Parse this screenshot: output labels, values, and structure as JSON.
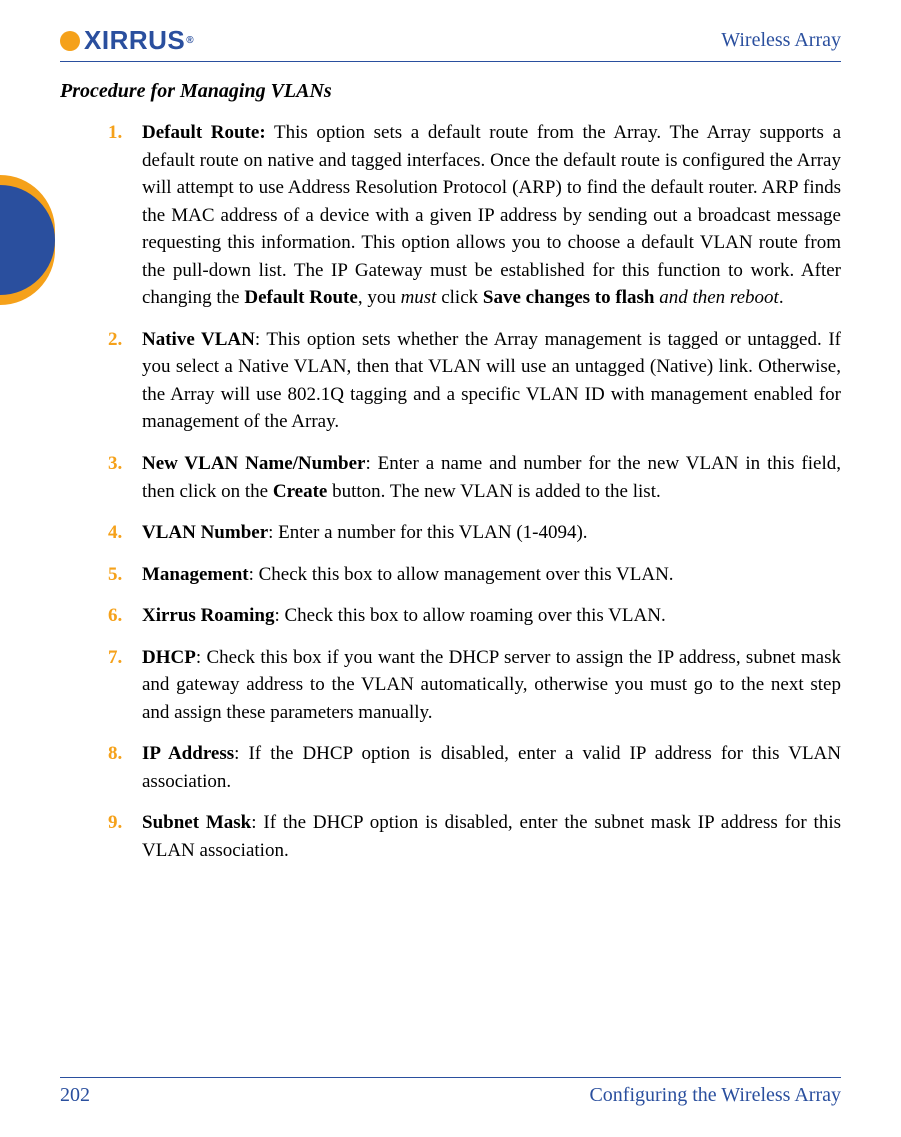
{
  "header": {
    "logo_text": "XIRRUS",
    "logo_reg": "®",
    "right": "Wireless Array"
  },
  "section_title": "Procedure for Managing VLANs",
  "steps": [
    {
      "num": "1.",
      "lead": "Default Route:",
      "text_a": " This option sets a default route from the Array. The Array supports a default route on native and tagged interfaces. Once the default route is configured the Array will attempt to use Address Resolution Protocol (ARP) to find the default router. ARP finds the MAC address of a device with a given IP address by sending out a broadcast message requesting this information. This option allows you to choose a default VLAN route from the pull-down list. The IP Gateway must be established for this function to work. After changing the ",
      "bold_mid": "Default Route",
      "text_b": ", you ",
      "ital_mid": "must",
      "text_c": " click ",
      "bold_end": "Save changes to flash",
      "ital_end": " and then reboot",
      "period": "."
    },
    {
      "num": "2.",
      "lead": "Native VLAN",
      "text_a": ": This option sets whether the Array management is tagged or untagged. If you select a Native VLAN, then that VLAN will use an untagged (Native) link. Otherwise, the Array will use 802.1Q tagging and a specific VLAN ID with management enabled for management of the Array."
    },
    {
      "num": "3.",
      "lead": "New VLAN Name/Number",
      "text_a": ": Enter a name and number for the new VLAN in this field, then click on the ",
      "bold_mid": "Create",
      "text_b": " button. The new VLAN is added to the list."
    },
    {
      "num": "4.",
      "lead": "VLAN Number",
      "text_a": ": Enter a number for this VLAN (1-4094)."
    },
    {
      "num": "5.",
      "lead": "Management",
      "text_a": ": Check this box to allow management over this VLAN."
    },
    {
      "num": "6.",
      "lead": "Xirrus Roaming",
      "text_a": ": Check this box to allow roaming over this VLAN."
    },
    {
      "num": "7.",
      "lead": "DHCP",
      "text_a": ": Check this box if you want the DHCP server to assign the IP address, subnet mask and gateway address to the VLAN automatically, otherwise you must go to the next step and assign these parameters manually."
    },
    {
      "num": "8.",
      "lead": "IP Address",
      "text_a": ": If the DHCP option is disabled, enter a valid IP address for this VLAN association."
    },
    {
      "num": "9.",
      "lead": "Subnet Mask",
      "text_a": ": If the DHCP option is disabled, enter the subnet mask IP address for this VLAN association."
    }
  ],
  "footer": {
    "page_num": "202",
    "chapter": "Configuring the Wireless Array"
  }
}
